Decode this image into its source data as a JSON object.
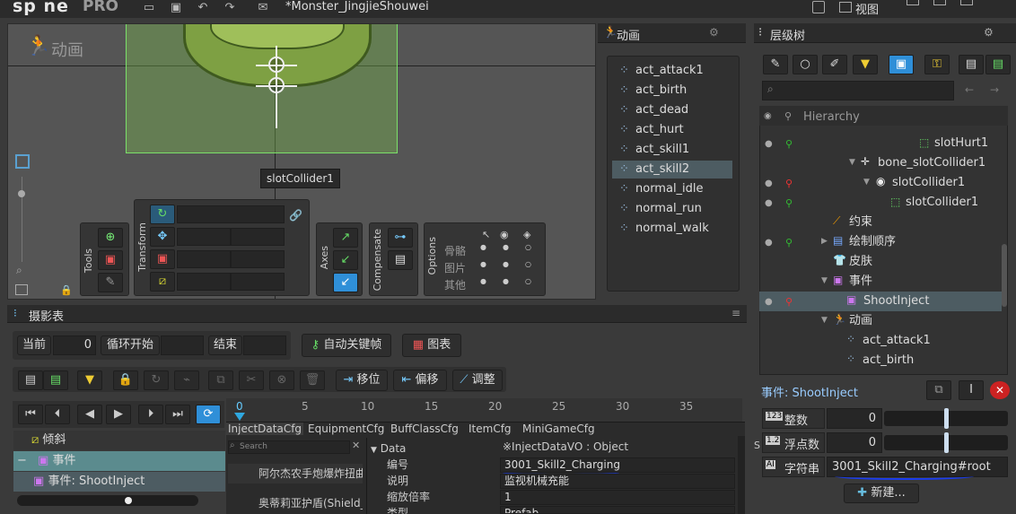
{
  "app": {
    "logo": "sp ne",
    "logo_pro": "PRO",
    "window_title": "*Monster_JingjieShouwei",
    "view_menu": "视图"
  },
  "viewport": {
    "mode_label": "动画",
    "tooltip": "slotCollider1"
  },
  "tool_panels": {
    "tools_label": "Tools",
    "transform_label": "Transform",
    "axes_label": "Axes",
    "compensate_label": "Compensate",
    "options_label": "Options",
    "options_rows": [
      "骨骼",
      "图片",
      "其他"
    ]
  },
  "animation_panel": {
    "title": "动画",
    "items": [
      "act_attack1",
      "act_birth",
      "act_dead",
      "act_hurt",
      "act_skill1",
      "act_skill2",
      "normal_idle",
      "normal_run",
      "normal_walk"
    ],
    "selected": "act_skill2"
  },
  "hierarchy": {
    "title": "层级树",
    "header": "Hierarchy",
    "rows": [
      {
        "label": "slotHurt1",
        "icon": "slot-icon"
      },
      {
        "label": "bone_slotCollider1",
        "icon": "bone-icon"
      },
      {
        "label": "slotCollider1",
        "icon": "slot-circle-icon"
      },
      {
        "label": "slotCollider1",
        "icon": "bbox-icon"
      },
      {
        "label": "约束",
        "icon": "constraint-icon"
      },
      {
        "label": "绘制顺序",
        "icon": "draworder-icon"
      },
      {
        "label": "皮肤",
        "icon": "skin-icon"
      },
      {
        "label": "事件",
        "icon": "event-icon"
      },
      {
        "label": "ShootInject",
        "icon": "event-item-icon"
      },
      {
        "label": "动画",
        "icon": "animation-icon"
      },
      {
        "label": "act_attack1",
        "icon": "anim-item-icon"
      },
      {
        "label": "act_birth",
        "icon": "anim-item-icon"
      }
    ]
  },
  "event_panel": {
    "title": "事件: ShootInject",
    "int_label": "整数",
    "int_value": "0",
    "float_label": "浮点数",
    "float_value": "0",
    "string_label": "字符串",
    "string_value": "3001_Skill2_Charging#root",
    "new_button": "新建..."
  },
  "dopesheet": {
    "title": "摄影表",
    "current_label": "当前",
    "current_value": "0",
    "loop_label": "循环开始",
    "end_label": "结束",
    "autokey_button": "自动关键帧",
    "graph_button": "图表",
    "offset_label": "移位",
    "offset2_label": "偏移",
    "adjust_label": "调整",
    "ruler": [
      "0",
      "5",
      "10",
      "15",
      "20",
      "25",
      "30",
      "35"
    ],
    "rows": [
      "倾斜",
      "事件",
      "事件: ShootInject"
    ]
  },
  "inject_panel": {
    "tabs": [
      "InjectDataCfg",
      "EquipmentCfg",
      "BuffClassCfg",
      "ItemCfg",
      "MiniGameCfg"
    ],
    "search_placeholder": "Search",
    "list": [
      "阿尔杰农手炮爆炸扭曲",
      "奥蒂莉亚护盾(Shield_E"
    ],
    "props": [
      {
        "label": "Data",
        "value": "※InjectDataVO : Object"
      },
      {
        "label": "编号",
        "value": "3001_Skill2_Charging"
      },
      {
        "label": "说明",
        "value": "监视机械充能"
      },
      {
        "label": "缩放倍率",
        "value": "1"
      },
      {
        "label": "类型",
        "value": "Prefab"
      }
    ]
  },
  "colors": {
    "accent": "#2f8fd8",
    "selection": "#4d5c62",
    "bbox": "#7be06a"
  }
}
